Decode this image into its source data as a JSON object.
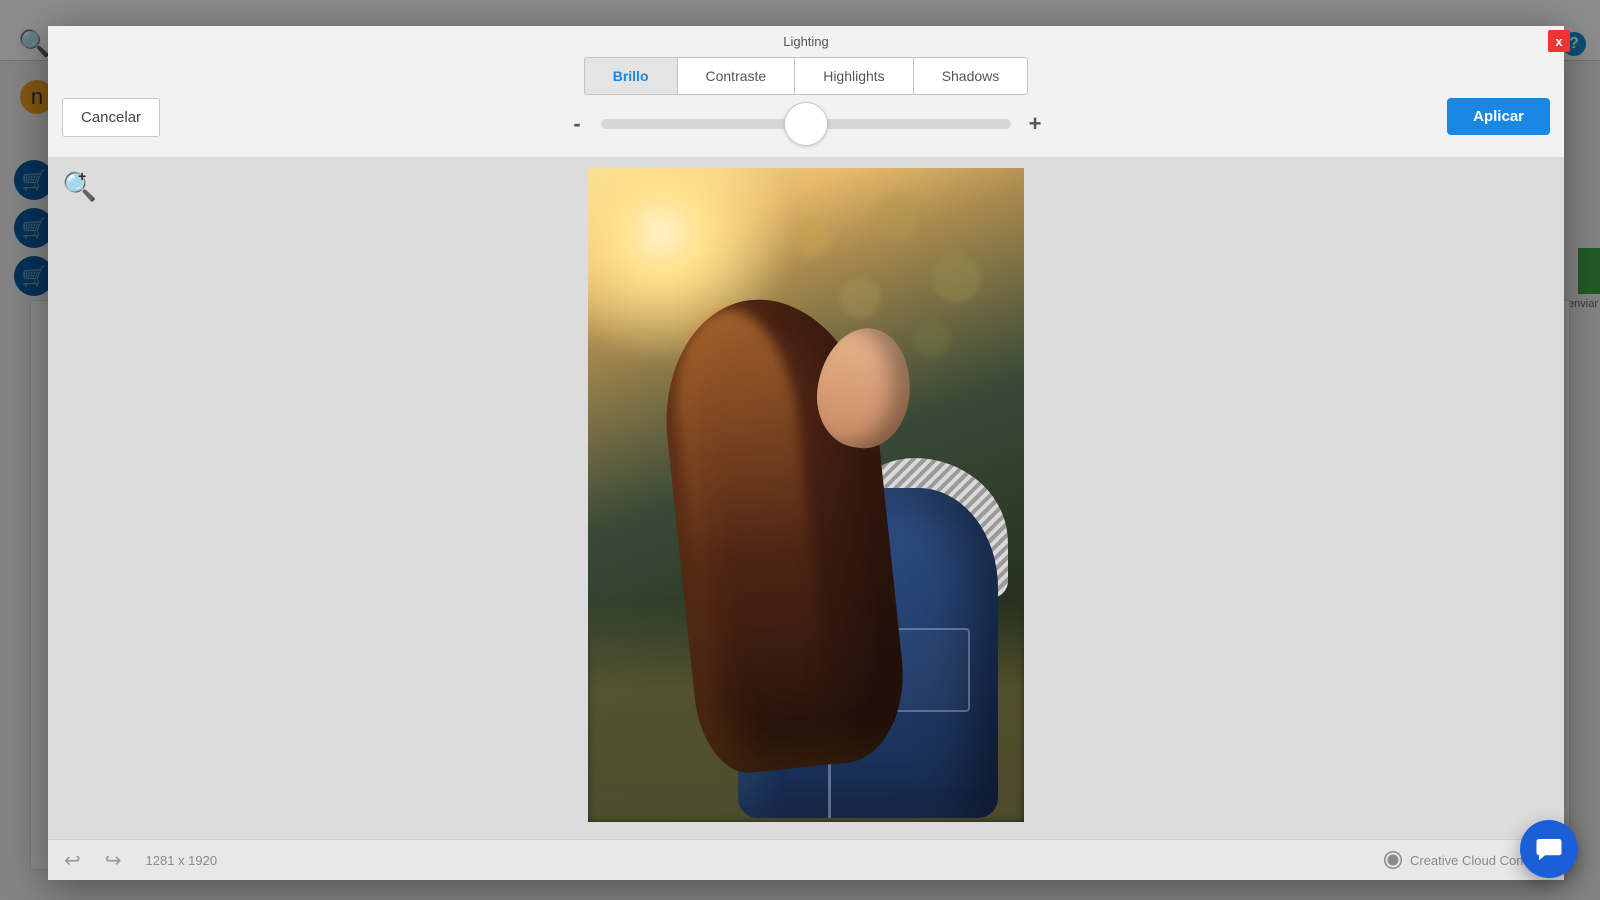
{
  "background": {
    "help_icon_text": "?",
    "avatar_letter": "n",
    "send_label": "enviar"
  },
  "modal": {
    "title": "Lighting",
    "close_label": "x",
    "cancel_label": "Cancelar",
    "apply_label": "Aplicar",
    "tabs": [
      {
        "label": "Brillo",
        "active": true
      },
      {
        "label": "Contraste",
        "active": false
      },
      {
        "label": "Highlights",
        "active": false
      },
      {
        "label": "Shadows",
        "active": false
      }
    ],
    "slider": {
      "minus": "-",
      "plus": "+",
      "value_percent": 50
    }
  },
  "footer": {
    "dimensions": "1281 x 1920",
    "creative_cloud": "Creative Cloud Connect"
  }
}
